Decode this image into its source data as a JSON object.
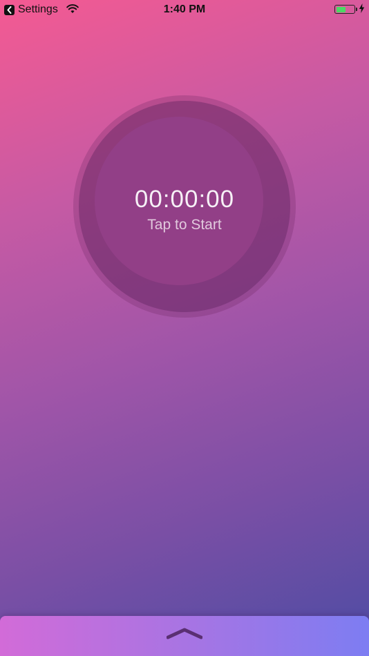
{
  "status_bar": {
    "back_label": "Settings",
    "time": "1:40 PM",
    "battery_level": 0.6,
    "battery_color": "#4cd964"
  },
  "timer": {
    "display": "00:00:00",
    "hint": "Tap to Start"
  },
  "drawer": {
    "icon": "chevron-up-icon"
  },
  "colors": {
    "gradient_start": "#f45a92",
    "gradient_end": "#4c4ca4",
    "dial_inner": "#923f87"
  }
}
